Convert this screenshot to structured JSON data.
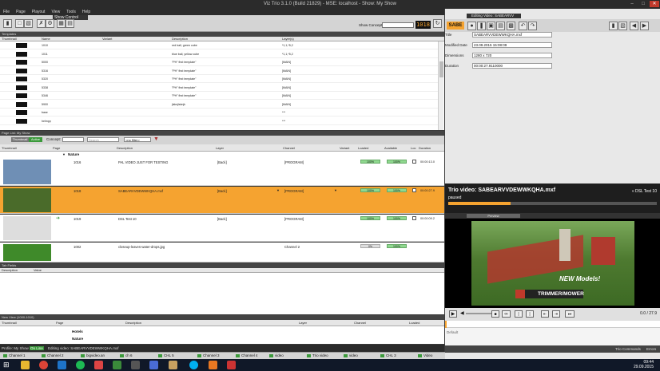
{
  "window": {
    "title": "Viz Trio 3.1.0 (Build 21829) - MSE: localhost - Show: My Show"
  },
  "menu": [
    "File",
    "Page",
    "Playout",
    "View",
    "Tools",
    "Help"
  ],
  "toolbar": {
    "show_control_label": "Show Control",
    "show_concept_label": "Show Concept",
    "show_concept_value": "",
    "counter": "1018"
  },
  "templates": {
    "section_label": "Templates",
    "columns": [
      "Thumbnail",
      "Name",
      "Variant",
      "Description",
      "Layer(s)"
    ],
    "rows": [
      {
        "name": "1010",
        "variant": "",
        "description": "red ball, green cube",
        "layers": "*1,1,*5,2"
      },
      {
        "name": "1011",
        "variant": "",
        "description": "blue ball, yellow cube",
        "layers": "*1,1,*5,2"
      },
      {
        "name": "5000",
        "variant": "",
        "description": "\"PH\" first template\"",
        "layers": "[MAIN]"
      },
      {
        "name": "5316",
        "variant": "",
        "description": "\"PH\" first template\"",
        "layers": "[MAIN]"
      },
      {
        "name": "5320",
        "variant": "",
        "description": "\"PH\" first template\"",
        "layers": "[MAIN]"
      },
      {
        "name": "5338",
        "variant": "",
        "description": "\"PH\" first template\"",
        "layers": "[MAIN]"
      },
      {
        "name": "5346",
        "variant": "",
        "description": "\"PH\" first template\"",
        "layers": "[MAIN]"
      },
      {
        "name": "5900",
        "variant": "",
        "description": "jlsknjlsknjk",
        "layers": "[MAIN]"
      },
      {
        "name": "base",
        "variant": "",
        "description": "",
        "layers": "***"
      },
      {
        "name": "helmpp",
        "variant": "",
        "description": "",
        "layers": "***"
      }
    ]
  },
  "pagelist": {
    "section_label": "Page List: My Show",
    "view_tabs": [
      "Thumbnail",
      "Active"
    ],
    "concept_label": "Concept:",
    "search_placeholder": "Search",
    "filter_value": "<no filter>",
    "columns": [
      "Thumbnail",
      "Page",
      "Description",
      "Layer",
      "Channel",
      "Variant",
      "Loaded",
      "Available",
      "Loc",
      "Duration"
    ],
    "group_label": "Nature",
    "rows": [
      {
        "page": "1016",
        "description": "PAL VIDEO JUST FOR TESTING",
        "layer": "[Back]",
        "channel": "[PROGRAM]",
        "loaded": "100%",
        "available": "100%",
        "duration": "00:00:13.0",
        "selected": false,
        "thumb_color": "#6f8fb5"
      },
      {
        "page": "1018",
        "description": "SABEARVVDEWWKQHA.mxf",
        "layer": "[Back]",
        "channel": "[PROGRAM]",
        "loaded": "100%",
        "available": "100%",
        "duration": "00:00:27.9",
        "selected": true,
        "thumb_color": "#4a6b2a"
      },
      {
        "page": "1019",
        "description": "DSL Test 10",
        "layer": "[Back]",
        "channel": "[PROGRAM]",
        "loaded": "100%",
        "available": "100%",
        "duration": "00:00:09.2",
        "selected": false,
        "thumb_color": "#ddd"
      },
      {
        "page": "1002",
        "description": "closeup-leaves-water-drops.jpg",
        "layer": "",
        "channel": "Channel 2",
        "loaded": "0%",
        "available": "100%",
        "duration": "",
        "selected": false,
        "thumb_color": "#3f8a2a"
      }
    ]
  },
  "tabfields": {
    "section_label": "Tab Fields",
    "columns": [
      "Description",
      "Value"
    ]
  },
  "newview": {
    "section_label": "New View (1000-1010)",
    "columns": [
      "Thumbnail",
      "Page",
      "Description",
      "Layer",
      "Channel",
      "Loaded"
    ],
    "groups": [
      "Hotels",
      "Nature"
    ]
  },
  "statusbar": {
    "profile": "Profile: My Show",
    "on_line": "On Line",
    "editing": "Editing video: SABEARVVDEWWKQHA.mxf"
  },
  "channels": [
    "Channel 1",
    "Channel 2",
    "bigvideo.an",
    "ch 6",
    "CHL 5",
    "Channel 3",
    "Channel 4",
    "video",
    "Trio video",
    "video",
    "CHL 3",
    "Video"
  ],
  "right": {
    "header_label": "Editing Video: SABEARVV",
    "badge": "SABE",
    "fields": [
      {
        "label": "Title",
        "value": "SABEARVVDEWWKQHA.mxf"
      },
      {
        "label": "Modified Date",
        "value": "23.09.2015 15:08:09"
      },
      {
        "label": "Dimensions",
        "value": "1280 x 720"
      },
      {
        "label": "Duration",
        "value": "00:00:27.9110000"
      }
    ],
    "video_title": "Trio video: SABEARVVDEWWKQHA.mxf",
    "status": "paused",
    "dsl_label": "« DSL Test 10",
    "preview_label": "Preview",
    "preview_caption_1": "NEW Models!",
    "preview_brand": "TRIMMER/MOWER",
    "time_readout": "0.0 / 27.9",
    "default_label": "Default",
    "tab_1": "Trio Commands",
    "tab_2": "Errors"
  },
  "taskbar": {
    "time": "09:44",
    "date": "29.09.2015"
  },
  "colors": {
    "accent": "#f5a330",
    "selected_row": "#f5a330",
    "loaded_green": "#8fd88f",
    "dark": "#2b2b2b"
  }
}
